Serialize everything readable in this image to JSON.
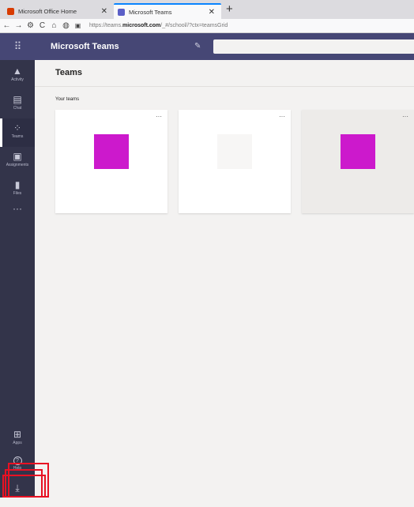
{
  "browser": {
    "tabs": [
      {
        "title": "Microsoft Office Home",
        "active": false,
        "close": "✕",
        "icon_color": "#d83b01"
      },
      {
        "title": "Microsoft Teams",
        "active": true,
        "close": "✕",
        "icon_color": "#5b5fc7"
      }
    ],
    "new_tab": "+",
    "nav": {
      "back": "←",
      "forward": "→",
      "settings": "⚙",
      "reload": "C",
      "home": "⌂",
      "shield": "◍",
      "lock": "🔒"
    },
    "url": {
      "prefix": "https://teams.",
      "domain": "microsoft.com",
      "suffix": "/_#/school//?ctx=teamsGrid"
    }
  },
  "app": {
    "title": "Microsoft Teams",
    "waffle": "⠿",
    "compose_icon": "✎",
    "search_placeholder": ""
  },
  "rail": {
    "items": [
      {
        "label": "Activity",
        "glyph": "🔔"
      },
      {
        "label": "Chat",
        "glyph": "▤"
      },
      {
        "label": "Teams",
        "glyph": "⁘",
        "selected": true
      },
      {
        "label": "Assignments",
        "glyph": "▣"
      },
      {
        "label": "Files",
        "glyph": "▮"
      },
      {
        "label": "",
        "glyph": "···"
      }
    ],
    "bottom": [
      {
        "label": "Apps",
        "glyph": "⊞"
      },
      {
        "label": "Help",
        "glyph": "?"
      },
      {
        "label": "",
        "glyph": "⤓"
      }
    ]
  },
  "page": {
    "title": "Teams",
    "section_label": "Your teams"
  },
  "teams": [
    {
      "more": "···",
      "avatar_color": "#cc19cc",
      "hovered": false
    },
    {
      "more": "···",
      "avatar_color": "#f7f6f5",
      "hovered": false
    },
    {
      "more": "···",
      "avatar_color": "#cc19cc",
      "hovered": true
    }
  ],
  "colors": {
    "header": "#464775",
    "rail": "#33344a",
    "highlight": "#e81123"
  }
}
